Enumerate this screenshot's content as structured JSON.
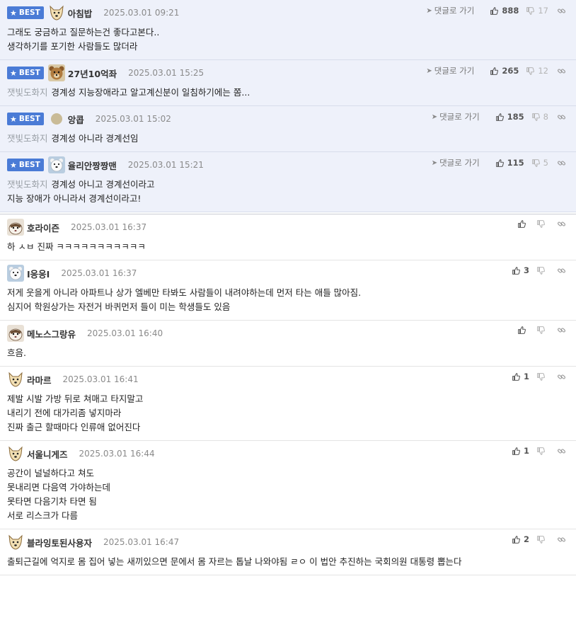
{
  "best_comments": [
    {
      "badge": "BEST",
      "author": "아침밥",
      "avatar": "dog-icon",
      "date": "2025.03.01 09:21",
      "reply_label": "댓글로 가기",
      "up": "888",
      "down": "17",
      "source": "",
      "lines": [
        "그래도 궁금하고 질문하는건 좋다고본다..",
        "생각하기를 포기한 사람들도 많더라"
      ]
    },
    {
      "badge": "BEST",
      "author": "27년10억좌",
      "avatar": "bear-icon",
      "date": "2025.03.01 15:25",
      "reply_label": "댓글로 가기",
      "up": "265",
      "down": "12",
      "source": "잿빛도화지",
      "lines": [
        "경계성 지능장애라고 알고계신분이 일침하기에는 쫌..."
      ]
    },
    {
      "badge": "BEST",
      "author": "앙콥",
      "avatar": "dot-icon",
      "date": "2025.03.01 15:02",
      "reply_label": "댓글로 가기",
      "up": "185",
      "down": "8",
      "source": "잿빛도화지",
      "lines": [
        "경계성 아니라 경계선임"
      ]
    },
    {
      "badge": "BEST",
      "author": "율리안짱짱맨",
      "avatar": "polarbear-icon",
      "date": "2025.03.01 15:21",
      "reply_label": "댓글로 가기",
      "up": "115",
      "down": "5",
      "source": "잿빛도화지",
      "lines": [
        "경계성 아니고 경계선이라고",
        "지능 장애가 아니라서 경계선이라고!"
      ]
    }
  ],
  "comments": [
    {
      "author": "호라이즌",
      "avatar": "ferret-icon",
      "date": "2025.03.01 16:37",
      "up": "",
      "lines": [
        "하 ㅅㅂ 진짜 ㅋㅋㅋㅋㅋㅋㅋㅋㅋㅋㅋ"
      ]
    },
    {
      "author": "I응응I",
      "avatar": "polarbear-icon",
      "date": "2025.03.01 16:37",
      "up": "3",
      "lines": [
        "저게 웃을게 아니라 아파트나 상가 엘베만 타봐도 사람들이 내려야하는데 먼저 타는 애들 많아짐.",
        "심지어 학원상가는 자전거 바퀴먼저 들이 미는 학생들도 있음"
      ]
    },
    {
      "author": "메노스그랑유",
      "avatar": "ferret-icon",
      "date": "2025.03.01 16:40",
      "up": "",
      "lines": [
        "흐음."
      ]
    },
    {
      "author": "라마르",
      "avatar": "dog-icon",
      "date": "2025.03.01 16:41",
      "up": "1",
      "lines": [
        "제발 시발 가방 뒤로 쳐매고 타지말고",
        "내리기 전에 대가리좀 넣지마라",
        "진짜 출근 할때마다 인류애 없어진다"
      ]
    },
    {
      "author": "서울니게즈",
      "avatar": "dog-icon",
      "date": "2025.03.01 16:44",
      "up": "1",
      "lines": [
        "공간이 널널하다고 쳐도",
        "못내리면 다음역 가야하는데",
        "못타면 다음기차 타면 됨",
        "서로 리스크가 다름"
      ]
    },
    {
      "author": "블라잉토된사용자",
      "avatar": "dog-icon",
      "date": "2025.03.01 16:47",
      "up": "2",
      "lines": [
        "출퇴근길에 억지로 몸 집어 넣는 새끼있으면 문에서 몸 자르는 톱날 나와야됨 ㄹㅇ 이 법안 추진하는 국회의원 대통령 뽑는다"
      ]
    }
  ],
  "colors": {
    "best_bg": "#eef1fa",
    "badge": "#4a7bd6",
    "muted": "#8a8a8a"
  }
}
